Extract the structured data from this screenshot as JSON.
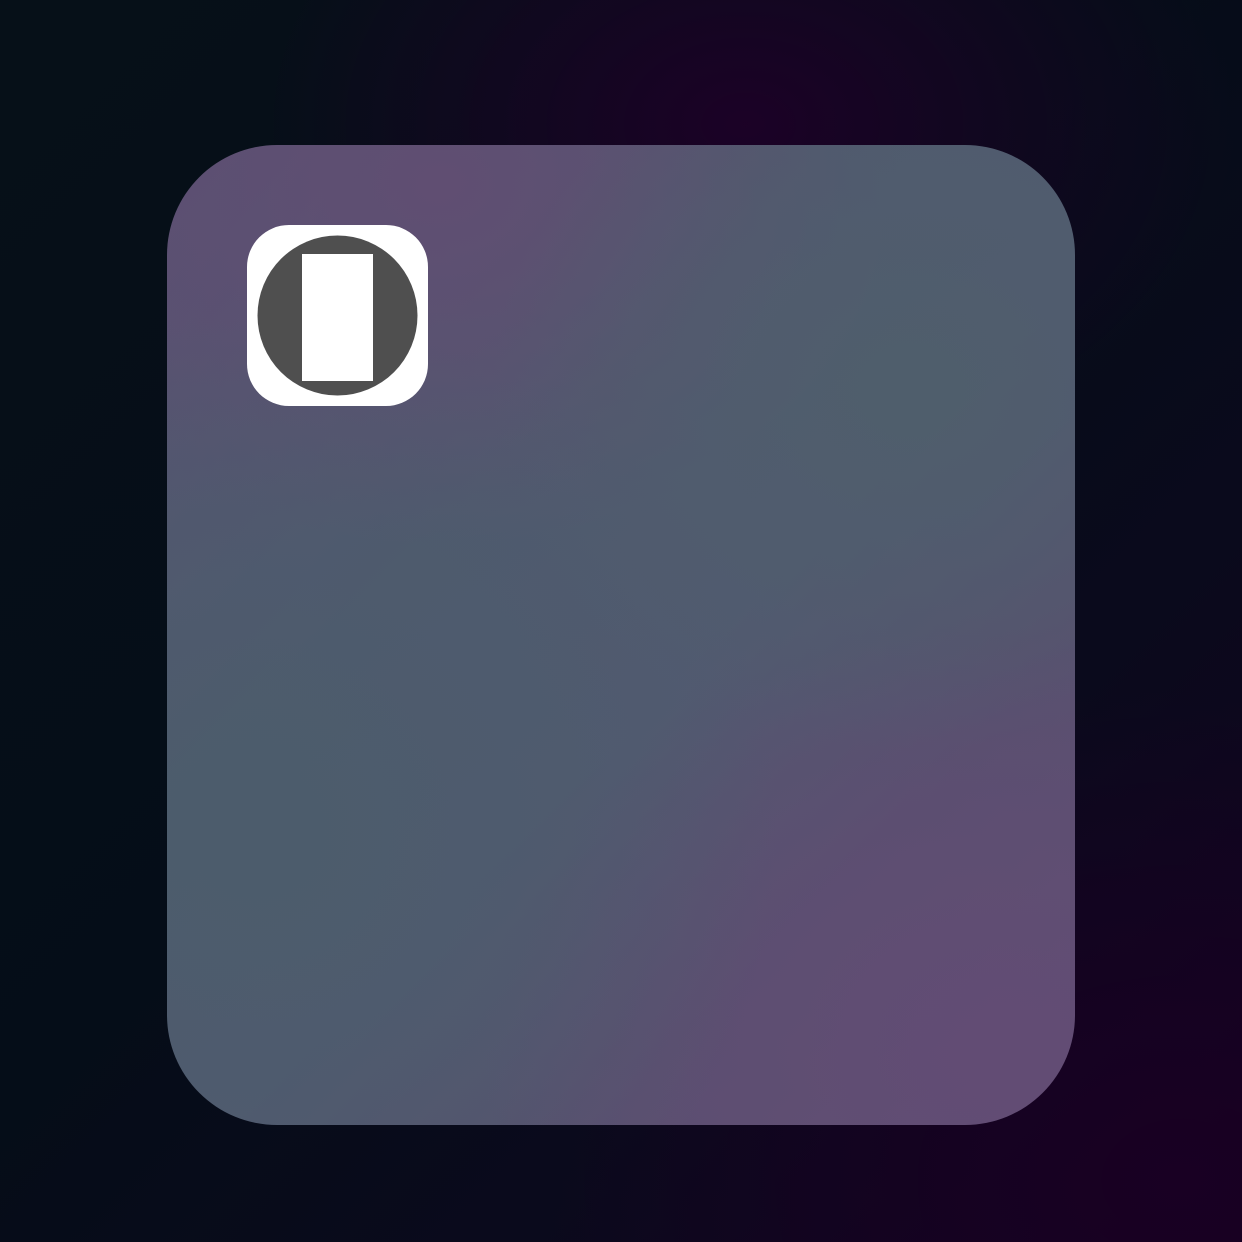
{
  "wallpaper": {
    "colors": [
      "#061018",
      "#12021f"
    ]
  },
  "widget": {
    "background_colors": [
      "#5a4f72",
      "#4f5a6e",
      "#604f73"
    ],
    "app": {
      "icon": "phone-in-circle-icon",
      "icon_bg_color": "#ffffff",
      "icon_fg_color": "#4f4f4f"
    }
  }
}
